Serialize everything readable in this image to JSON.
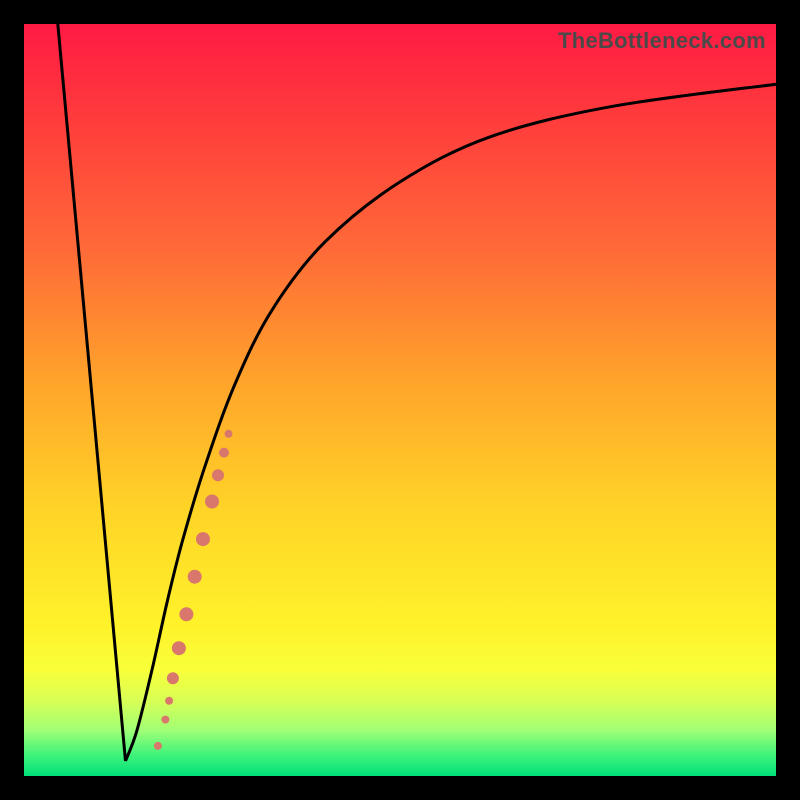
{
  "watermark": "TheBottleneck.com",
  "colors": {
    "frame": "#000000",
    "curve": "#000000",
    "markers": "#d9776c"
  },
  "chart_data": {
    "type": "line",
    "title": "",
    "xlabel": "",
    "ylabel": "",
    "xlim": [
      0,
      100
    ],
    "ylim": [
      0,
      100
    ],
    "series": [
      {
        "name": "left-line",
        "x": [
          4.5,
          13.5
        ],
        "y": [
          100,
          2
        ]
      },
      {
        "name": "right-curve",
        "x": [
          13.5,
          15,
          17,
          19,
          21,
          24,
          28,
          33,
          40,
          50,
          62,
          78,
          100
        ],
        "y": [
          2,
          6,
          14,
          23,
          31,
          41,
          52,
          62,
          71,
          79,
          85,
          89,
          92
        ]
      }
    ],
    "markers": [
      {
        "x": 17.8,
        "y": 4.0,
        "r": 4
      },
      {
        "x": 18.8,
        "y": 7.5,
        "r": 4
      },
      {
        "x": 19.3,
        "y": 10.0,
        "r": 4
      },
      {
        "x": 19.8,
        "y": 13.0,
        "r": 6
      },
      {
        "x": 20.6,
        "y": 17.0,
        "r": 7
      },
      {
        "x": 21.6,
        "y": 21.5,
        "r": 7
      },
      {
        "x": 22.7,
        "y": 26.5,
        "r": 7
      },
      {
        "x": 23.8,
        "y": 31.5,
        "r": 7
      },
      {
        "x": 25.0,
        "y": 36.5,
        "r": 7
      },
      {
        "x": 25.8,
        "y": 40.0,
        "r": 6
      },
      {
        "x": 26.6,
        "y": 43.0,
        "r": 5
      },
      {
        "x": 27.2,
        "y": 45.5,
        "r": 4
      }
    ]
  }
}
